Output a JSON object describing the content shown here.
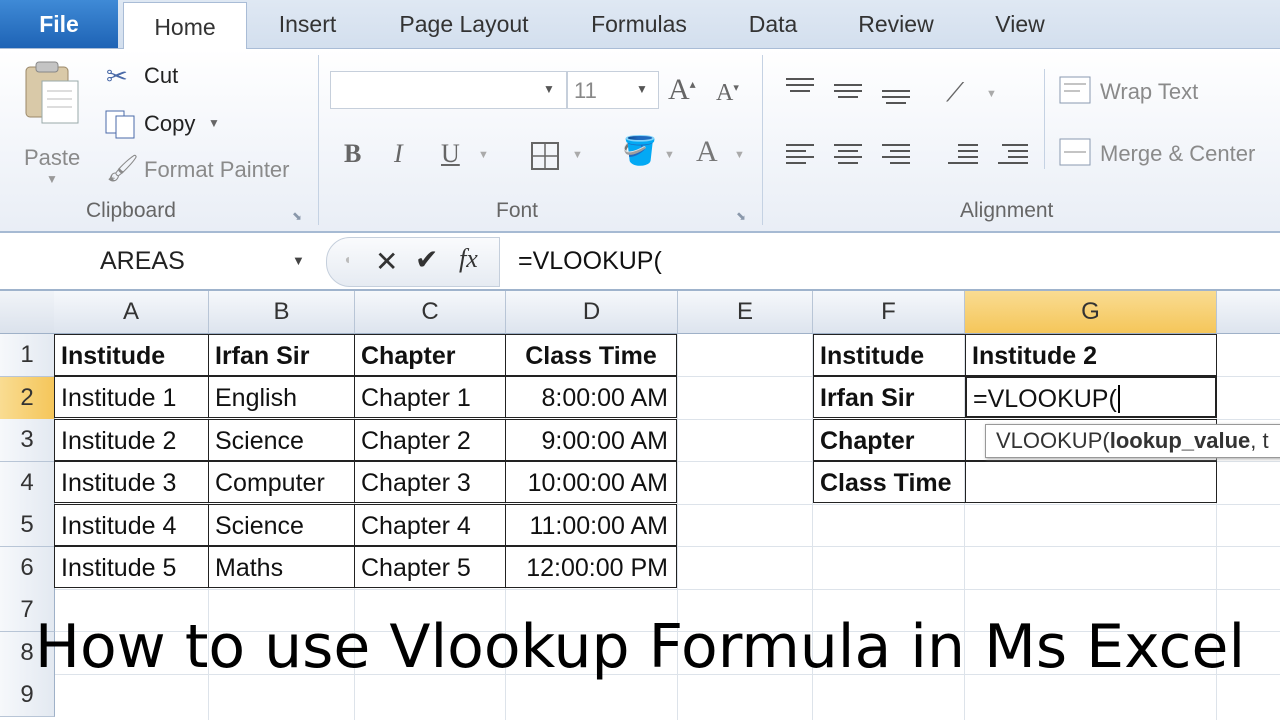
{
  "tabs": [
    "File",
    "Home",
    "Insert",
    "Page Layout",
    "Formulas",
    "Data",
    "Review",
    "View"
  ],
  "clipboard": {
    "paste": "Paste",
    "cut": "Cut",
    "copy": "Copy",
    "format_painter": "Format Painter",
    "label": "Clipboard"
  },
  "font": {
    "font_name": "",
    "font_size": "11",
    "bold": "B",
    "italic": "I",
    "underline": "U",
    "label": "Font",
    "font_color_glyph": "A"
  },
  "alignment": {
    "wrap_text": "Wrap Text",
    "merge_center": "Merge & Center",
    "label": "Alignment"
  },
  "formula_bar": {
    "name_box": "AREAS",
    "formula": "=VLOOKUP(",
    "fx": "fx"
  },
  "columns": [
    "A",
    "B",
    "C",
    "D",
    "E",
    "F",
    "G"
  ],
  "rows": [
    "1",
    "2",
    "3",
    "4",
    "5",
    "6",
    "7",
    "8",
    "9"
  ],
  "table": {
    "headers": [
      "Institude",
      "Irfan Sir",
      "Chapter",
      "Class Time"
    ],
    "rows": [
      [
        "Institude 1",
        "English",
        "Chapter 1",
        "8:00:00 AM"
      ],
      [
        "Institude 2",
        "Science",
        "Chapter 2",
        "9:00:00 AM"
      ],
      [
        "Institude 3",
        "Computer",
        "Chapter 3",
        "10:00:00 AM"
      ],
      [
        "Institude 4",
        "Science",
        "Chapter 4",
        "11:00:00 AM"
      ],
      [
        "Institude 5",
        "Maths",
        "Chapter 5",
        "12:00:00 PM"
      ]
    ]
  },
  "lookup": {
    "labels": [
      "Institude",
      "Irfan Sir",
      "Chapter",
      "Class Time"
    ],
    "g1": "Institude 2",
    "g2": "=VLOOKUP("
  },
  "tooltip": "VLOOKUP(lookup_value, t",
  "caption": "How to use Vlookup Formula in Ms Excel",
  "colors": {
    "file_tab": "#2b6fc2",
    "selected_header": "#f7d27a"
  }
}
